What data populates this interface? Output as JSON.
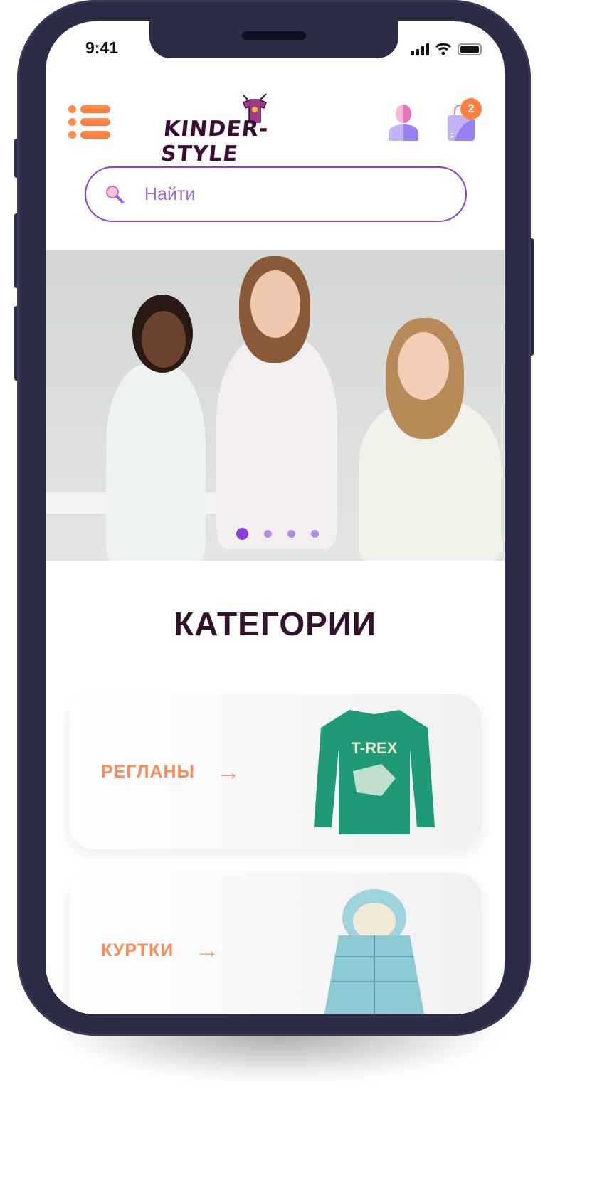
{
  "status_bar": {
    "time": "9:41"
  },
  "header": {
    "logo_text": "KINDER-STYLE",
    "cart_count": "2"
  },
  "search": {
    "placeholder": "Найти"
  },
  "carousel": {
    "slide_count": 4,
    "active_index": 0
  },
  "categories": {
    "title": "КАТЕГОРИИ",
    "items": [
      {
        "label": "РЕГЛАНЫ",
        "image_text": "T-REX"
      },
      {
        "label": "КУРТКИ"
      }
    ]
  },
  "colors": {
    "accent": "#ff8a45",
    "purple": "#8a3fc8",
    "title": "#32112e"
  }
}
